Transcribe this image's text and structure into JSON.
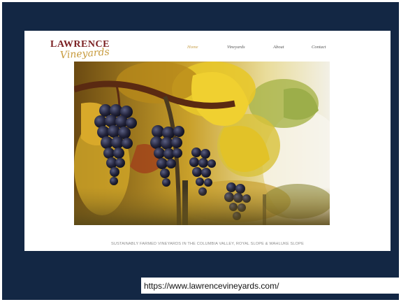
{
  "website": {
    "logo": {
      "top": "LAWRENCE",
      "bottom": "Vineyards"
    },
    "nav": {
      "home": "Home",
      "vineyards": "Vineyards",
      "about": "About",
      "contact": "Contact"
    },
    "tagline": "SUSTAINABLY FARMED VINEYARDS IN THE COLUMBIA VALLEY, ROYAL SLOPE & WAHLUKE SLOPE"
  },
  "url_label": "https://www.lawrencevineyards.com/",
  "colors": {
    "slide_background": "#132744",
    "logo_red": "#7a1f22",
    "logo_gold": "#c79a3c",
    "nav_active": "#c9a24d"
  },
  "icons": {
    "hero_image": "grape-vine-photo"
  }
}
